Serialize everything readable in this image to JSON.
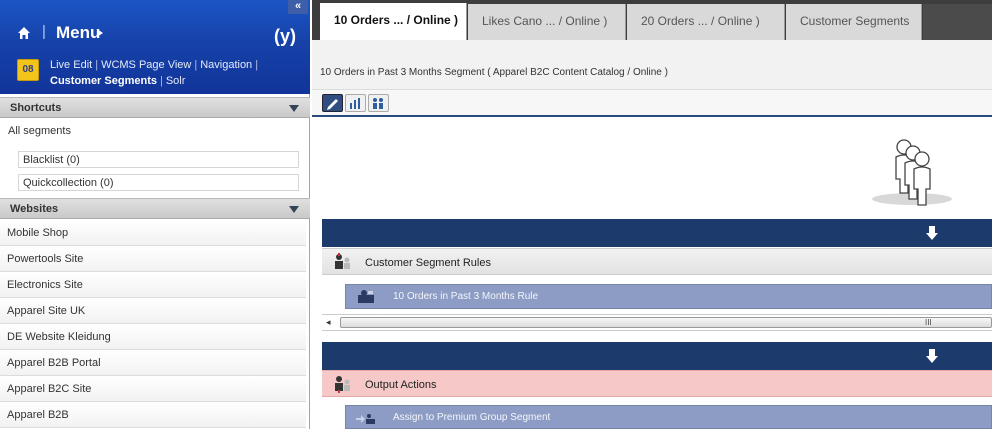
{
  "menu": {
    "title": "Menu",
    "separator": "|",
    "collapse": "«",
    "app_icon_text": "08",
    "links": [
      {
        "label": "Live Edit"
      },
      {
        "label": "WCMS Page View"
      },
      {
        "label": "Navigation"
      },
      {
        "label": "Customer Segments",
        "active": true
      },
      {
        "label": "Solr"
      }
    ],
    "brand": "(y)"
  },
  "shortcuts": {
    "header": "Shortcuts",
    "all_segments": "All segments",
    "items": [
      "Blacklist (0)",
      "Quickcollection (0)"
    ]
  },
  "websites": {
    "header": "Websites",
    "items": [
      "Mobile Shop",
      "Powertools Site",
      "Electronics Site",
      "Apparel Site UK",
      "DE Website Kleidung",
      "Apparel B2B Portal",
      "Apparel B2C Site",
      "Apparel B2B"
    ]
  },
  "tabs": [
    {
      "label": "10 Orders ... / Online )",
      "active": true
    },
    {
      "label": "Likes Cano ... / Online )"
    },
    {
      "label": "20 Orders ... / Online )"
    },
    {
      "label": "Customer Segments"
    }
  ],
  "subtitle": "10 Orders in Past 3 Months Segment ( Apparel B2C Content Catalog / Online )",
  "rules": {
    "header": "Customer Segment Rules",
    "row": "10 Orders in Past 3 Months Rule"
  },
  "actions": {
    "header": "Output Actions",
    "row": "Assign to Premium Group Segment"
  },
  "scroll": {
    "left": "◂",
    "grip": "III"
  },
  "colors": {
    "header_blue": "#1642a8",
    "flow_bar": "#1d3a6d",
    "row_blue": "#8d9cc4",
    "actions_pink": "#f6c8c8"
  }
}
